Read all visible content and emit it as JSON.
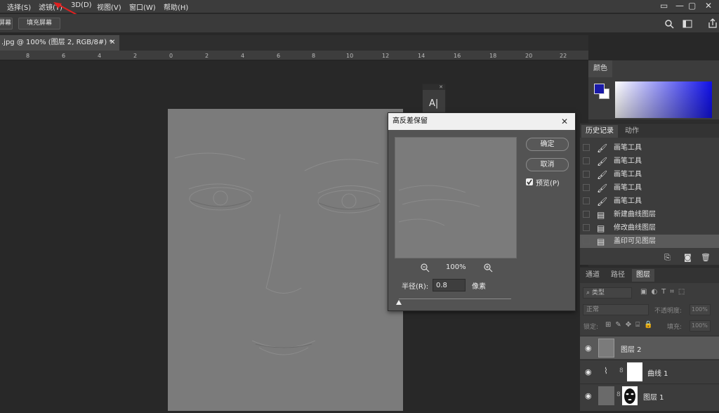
{
  "menubar": {
    "items": [
      "选择(S)",
      "滤镜(T)",
      "3D(D)",
      "视图(V)",
      "窗口(W)",
      "帮助(H)"
    ],
    "window_controls": [
      "▭",
      "—",
      "▢",
      "✕"
    ]
  },
  "options_bar": {
    "btn1": "屏幕",
    "btn2": "填充屏幕"
  },
  "document_tab": {
    "label": ".jpg @ 100% (图层 2, RGB/8#) *",
    "close": "✕"
  },
  "ruler": {
    "ticks": [
      "8",
      "6",
      "4",
      "2",
      "0",
      "2",
      "4",
      "6",
      "8",
      "10",
      "12",
      "14",
      "16",
      "18",
      "20",
      "22"
    ]
  },
  "mini_panel": {
    "glyph": "A|"
  },
  "dialog": {
    "title": "高反差保留",
    "close": "✕",
    "ok_label": "确定",
    "cancel_label": "取消",
    "preview_label": "预览(P)",
    "preview_checked": true,
    "zoom_value": "100%",
    "radius_label": "半径(R):",
    "radius_value": "0.8",
    "unit_label": "像素",
    "slider_position": 0.0
  },
  "color_panel": {
    "tab": "颜色",
    "foreground": "#1a1aa8",
    "background": "#ffffff"
  },
  "history_panel": {
    "tabs": [
      "历史记录",
      "动作"
    ],
    "items": [
      {
        "icon": "brush-icon",
        "label": "画笔工具"
      },
      {
        "icon": "brush-icon",
        "label": "画笔工具"
      },
      {
        "icon": "brush-icon",
        "label": "画笔工具"
      },
      {
        "icon": "brush-icon",
        "label": "画笔工具"
      },
      {
        "icon": "brush-icon",
        "label": "画笔工具"
      },
      {
        "icon": "document-icon",
        "label": "新建曲线图层"
      },
      {
        "icon": "document-icon",
        "label": "修改曲线图层"
      },
      {
        "icon": "document-icon",
        "label": "盖印可见图层"
      }
    ]
  },
  "layers_panel": {
    "tabs": [
      "通道",
      "路径",
      "图层"
    ],
    "filter_label": "类型",
    "blend_mode": "正常",
    "opacity_label": "不透明度:",
    "opacity_value": "100%",
    "lock_label": "锁定:",
    "fill_label": "填充:",
    "fill_value": "100%",
    "layers": [
      {
        "name": "图层 2",
        "selected": true
      },
      {
        "name": "曲线 1",
        "selected": false
      },
      {
        "name": "图层 1",
        "selected": false
      }
    ]
  }
}
